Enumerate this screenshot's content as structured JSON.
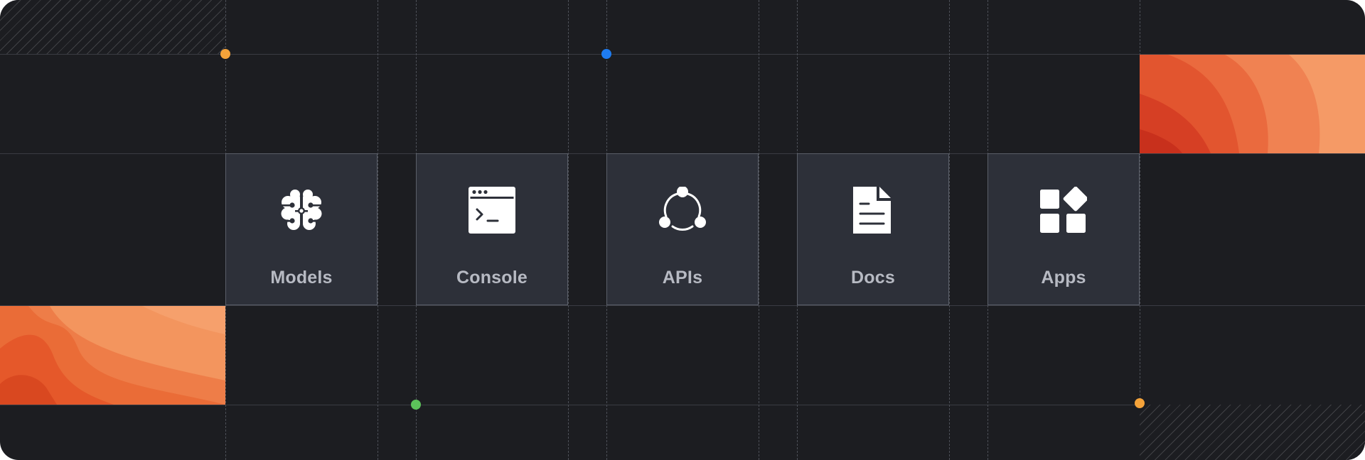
{
  "tiles": [
    {
      "id": "models",
      "label": "Models",
      "icon": "brain-icon"
    },
    {
      "id": "console",
      "label": "Console",
      "icon": "terminal-window-icon"
    },
    {
      "id": "apis",
      "label": "APIs",
      "icon": "connected-nodes-icon"
    },
    {
      "id": "docs",
      "label": "Docs",
      "icon": "document-icon"
    },
    {
      "id": "apps",
      "label": "Apps",
      "icon": "app-grid-icon"
    }
  ],
  "colors": {
    "background": "#1c1d21",
    "tile": "#2d3039",
    "tile_border": "#5a5e68",
    "label": "#b7bac3",
    "dot_orange": "#f5a33a",
    "dot_blue": "#1e7cf2",
    "dot_green": "#5cc25a",
    "accent_gradient": [
      "#c8281c",
      "#e24f2c",
      "#f0763a",
      "#f59962"
    ]
  }
}
